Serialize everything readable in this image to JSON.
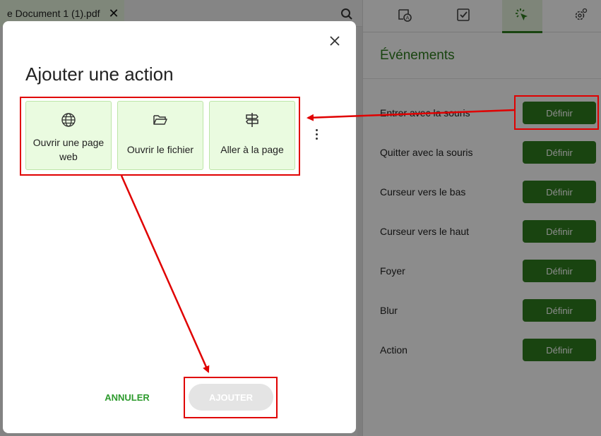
{
  "document": {
    "tab_title": "e Document 1 (1).pdf",
    "tab_close_icon": "close-icon",
    "search_icon": "search-icon"
  },
  "panel": {
    "tabs": [
      {
        "icon": "form-field-icon"
      },
      {
        "icon": "checkbox-icon"
      },
      {
        "icon": "click-action-icon",
        "active": true
      },
      {
        "icon": "settings-gear-icon"
      }
    ],
    "title": "Événements",
    "events": [
      {
        "label": "Entrer avec la souris",
        "button": "Définir"
      },
      {
        "label": "Quitter avec la souris",
        "button": "Définir"
      },
      {
        "label": "Curseur vers le bas",
        "button": "Définir"
      },
      {
        "label": "Curseur vers le haut",
        "button": "Définir"
      },
      {
        "label": "Foyer",
        "button": "Définir"
      },
      {
        "label": "Blur",
        "button": "Définir"
      },
      {
        "label": "Action",
        "button": "Définir"
      }
    ]
  },
  "dialog": {
    "title": "Ajouter une action",
    "close_icon": "close-icon",
    "actions": [
      {
        "label": "Ouvrir une page web",
        "icon": "globe-icon"
      },
      {
        "label": "Ouvrir le fichier",
        "icon": "folder-open-icon"
      },
      {
        "label": "Aller à la page",
        "icon": "signpost-icon"
      }
    ],
    "more_icon": "more-vertical-icon",
    "cancel_label": "ANNULER",
    "add_label": "AJOUTER"
  },
  "colors": {
    "accent": "#2e7d1e",
    "card_bg": "#eafbe0",
    "annotation": "#e00000"
  }
}
